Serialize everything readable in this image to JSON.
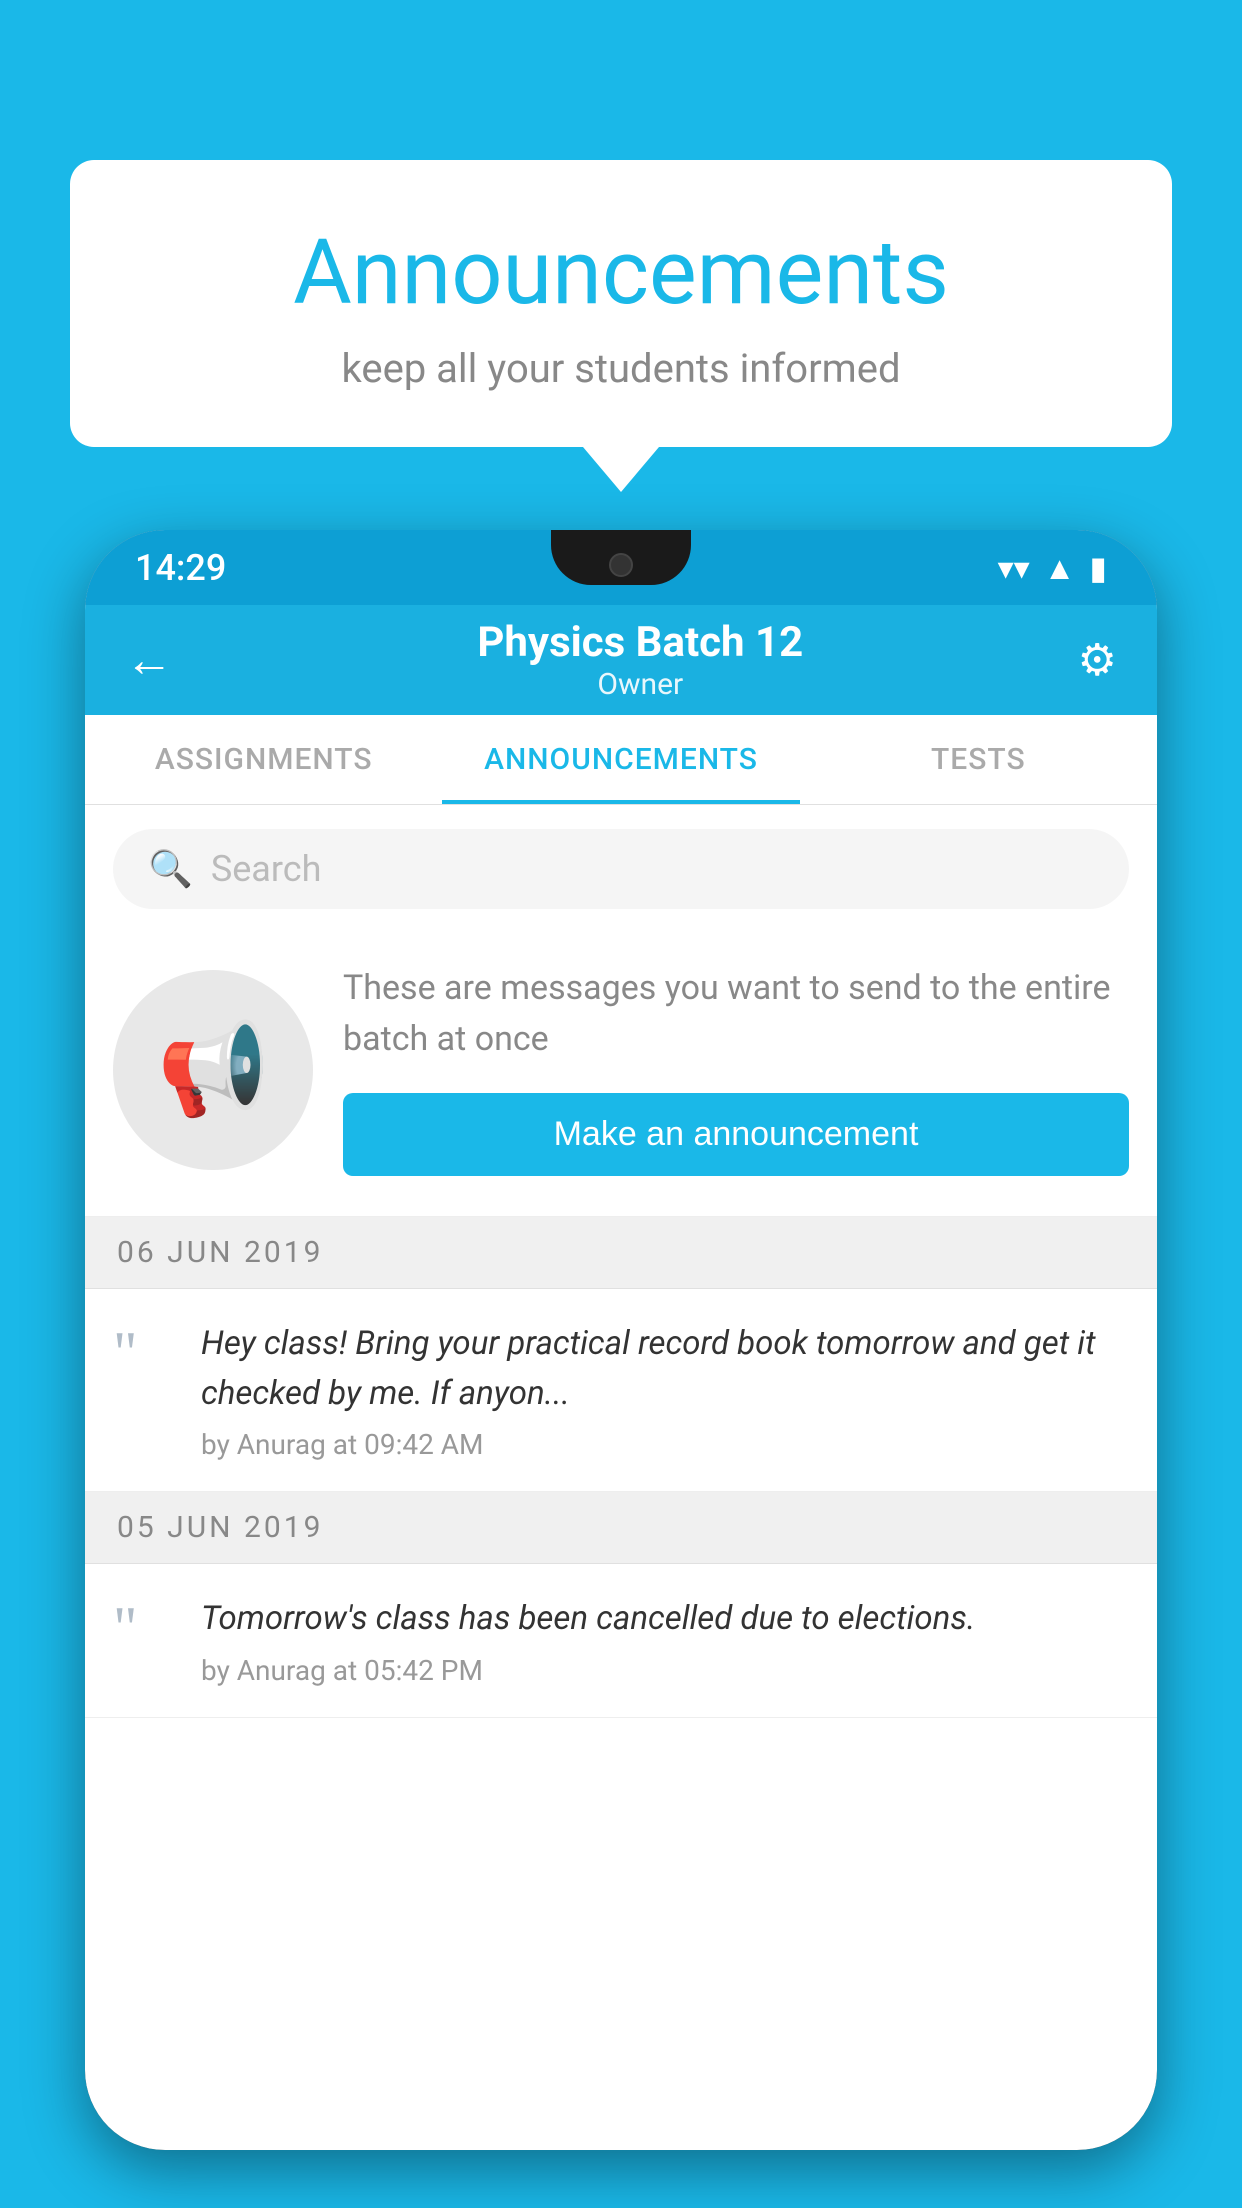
{
  "background_color": "#1ab8e8",
  "speech_bubble": {
    "title": "Announcements",
    "subtitle": "keep all your students informed"
  },
  "phone": {
    "status_bar": {
      "time": "14:29",
      "wifi": "▼",
      "signal": "▲",
      "battery": "▮"
    },
    "app_bar": {
      "title": "Physics Batch 12",
      "subtitle": "Owner",
      "back_label": "←",
      "settings_label": "⚙"
    },
    "tabs": [
      {
        "label": "ASSIGNMENTS",
        "active": false
      },
      {
        "label": "ANNOUNCEMENTS",
        "active": true
      },
      {
        "label": "TESTS",
        "active": false
      }
    ],
    "search": {
      "placeholder": "Search"
    },
    "announcement_prompt": {
      "description": "These are messages you want to send to the entire batch at once",
      "button_label": "Make an announcement"
    },
    "date_groups": [
      {
        "date": "06  JUN  2019",
        "items": [
          {
            "text": "Hey class! Bring your practical record book tomorrow and get it checked by me. If anyon...",
            "meta": "by Anurag at 09:42 AM"
          }
        ]
      },
      {
        "date": "05  JUN  2019",
        "items": [
          {
            "text": "Tomorrow's class has been cancelled due to elections.",
            "meta": "by Anurag at 05:42 PM"
          }
        ]
      }
    ]
  }
}
